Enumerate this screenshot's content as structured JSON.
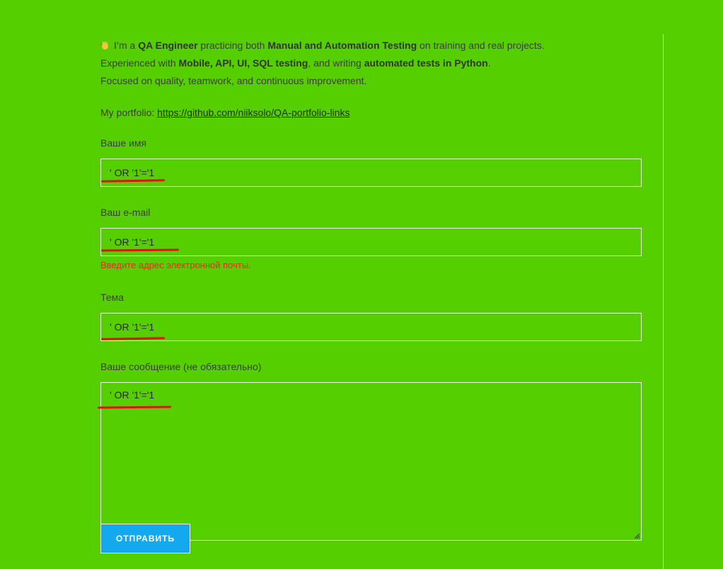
{
  "intro": {
    "line1": {
      "p1": "I’m a ",
      "b1": "QA Engineer",
      "p2": " practicing both ",
      "b2": "Manual and Automation Testing",
      "p3": " on training and real projects."
    },
    "line2": {
      "p1": "Experienced with ",
      "b1": "Mobile, API, UI, SQL testing",
      "p2": ", and writing ",
      "b2": "automated tests in Python",
      "p3": "."
    },
    "line3": "Focused on quality, teamwork, and continuous improvement.",
    "portfolio_label": "My portfolio: ",
    "portfolio_link": "https://github.com/niiksolo/QA-portfolio-links"
  },
  "form": {
    "name_label": "Ваше имя",
    "name_value": "' OR '1'='1",
    "email_label": "Ваш e-mail",
    "email_value": "' OR '1'='1",
    "email_error": "Введите адрес электронной почты.",
    "subject_label": "Тема",
    "subject_value": "' OR '1'='1",
    "message_label": "Ваше сообщение (не обязательно)",
    "message_value": "' OR '1'='1",
    "submit_label": "ОТПРАВИТЬ"
  },
  "colors": {
    "background": "#55cf00",
    "accent_button": "#14a8ee",
    "error": "#e0301e",
    "annotation": "#e0140e"
  },
  "icons": {
    "wave": "waving-hand-icon",
    "resize": "resize-grip-icon"
  }
}
